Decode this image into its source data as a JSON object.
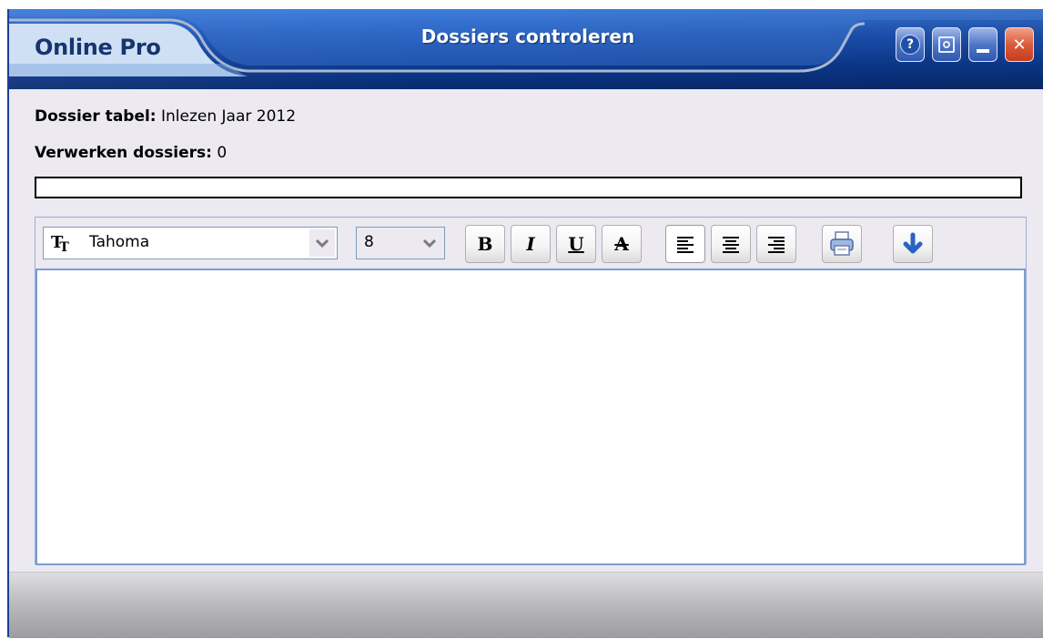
{
  "app": {
    "brand": "Online Pro",
    "window_title": "Dossiers controleren"
  },
  "window_buttons": {
    "help_icon": "help-icon",
    "screenshot_icon": "screenshot-icon",
    "minimize_icon": "minimize-icon",
    "close_icon": "close-icon",
    "help_glyph": "?",
    "close_glyph": "✕"
  },
  "info": {
    "dossier_tabel_label": "Dossier tabel:",
    "dossier_tabel_value": "Inlezen Jaar 2012",
    "verwerken_label": "Verwerken dossiers:",
    "verwerken_value": "0"
  },
  "progress": {
    "fraction": 0
  },
  "toolbar": {
    "font": "Tahoma",
    "font_size": "8",
    "bold_label": "B",
    "italic_label": "I",
    "underline_label": "U",
    "strike_label": "A",
    "align": "left"
  },
  "editor": {
    "text": ""
  },
  "colors": {
    "titlebar": "#0c3a92",
    "accent": "#2f6ad0",
    "close": "#dc5a3a",
    "content_bg": "#ece9f1"
  }
}
